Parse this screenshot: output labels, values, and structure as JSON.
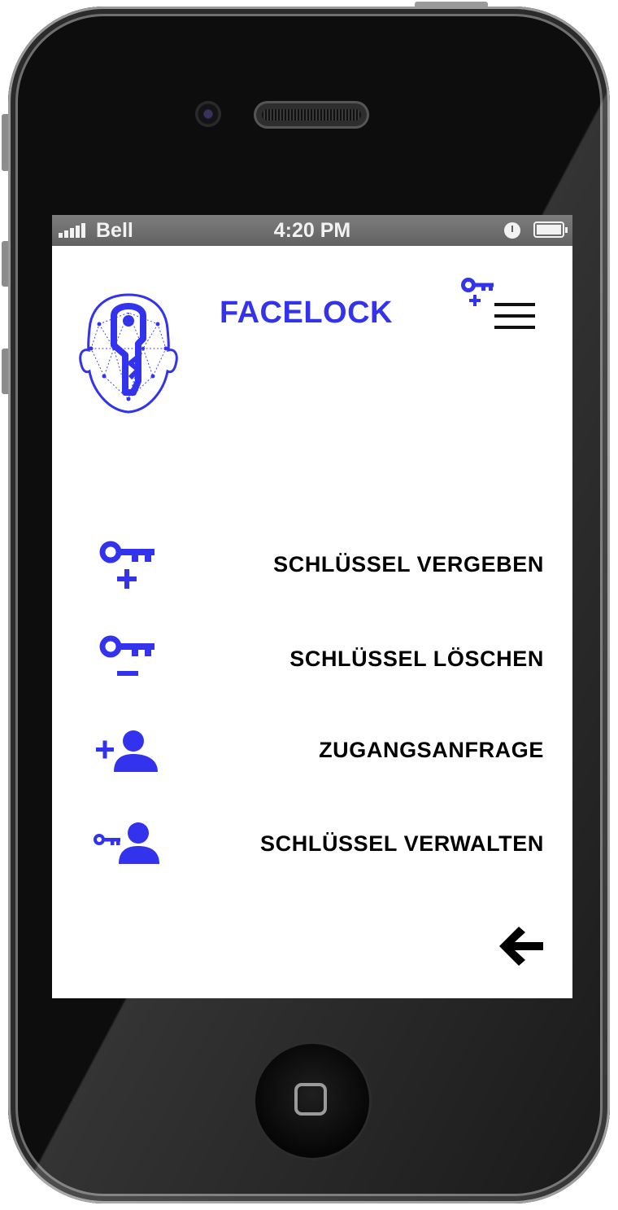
{
  "status_bar": {
    "carrier": "Bell",
    "time": "4:20 PM"
  },
  "header": {
    "title": "FACELOCK"
  },
  "menu": {
    "items": [
      {
        "label": "SCHLÜSSEL VERGEBEN",
        "icon": "key-plus-icon"
      },
      {
        "label": "SCHLÜSSEL LÖSCHEN",
        "icon": "key-minus-icon"
      },
      {
        "label": "ZUGANGSANFRAGE",
        "icon": "person-add-icon"
      },
      {
        "label": "SCHLÜSSEL VERWALTEN",
        "icon": "person-key-icon"
      }
    ]
  },
  "colors": {
    "accent": "#3333ee",
    "text": "#000000",
    "status_bar": "#6e6e6e",
    "device": "#0d0d0d"
  }
}
